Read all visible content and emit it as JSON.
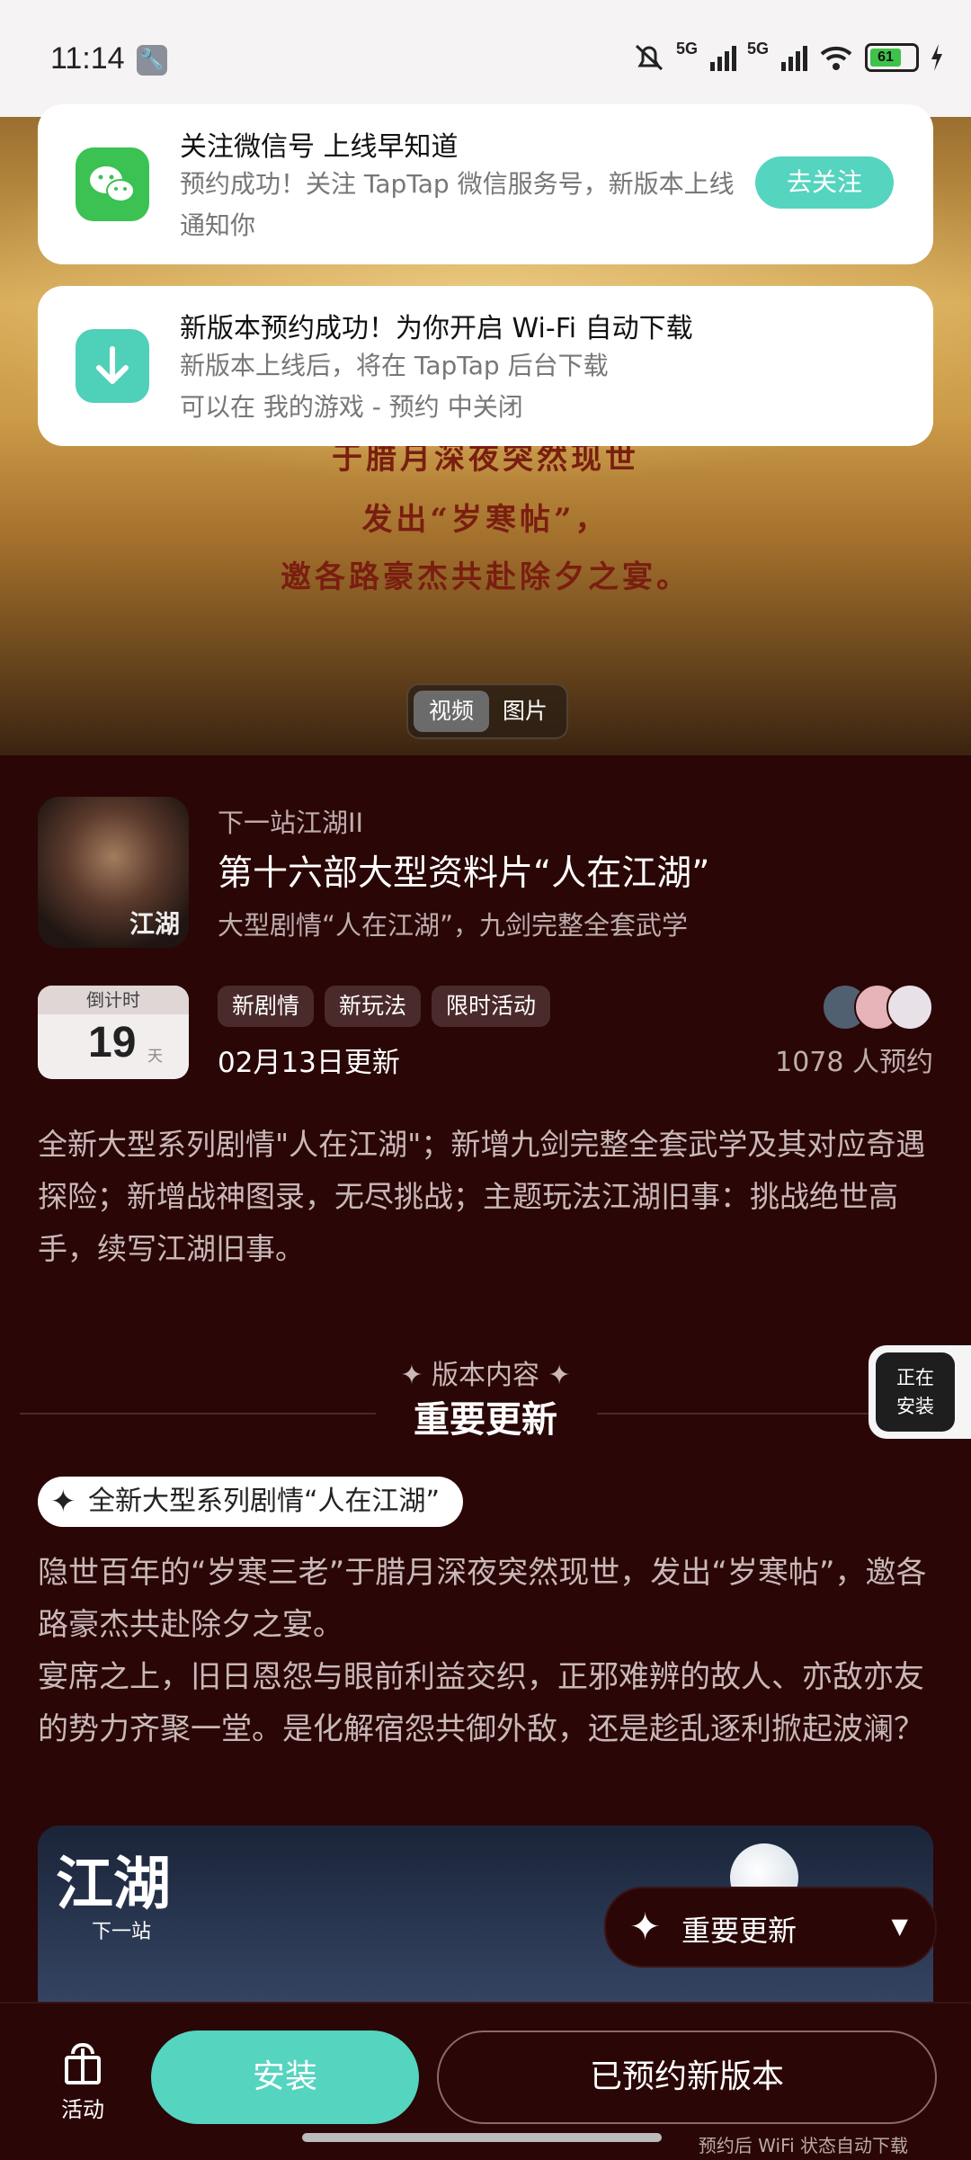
{
  "status_bar": {
    "time": "11:14",
    "network_1": "5G",
    "network_2": "5G",
    "battery": "61"
  },
  "notifications": [
    {
      "title": "关注微信号 上线早知道",
      "body": "预约成功！关注 TapTap 微信服务号，新版本上线通知你",
      "button": "去关注",
      "icon": "wechat-icon"
    },
    {
      "title": "新版本预约成功！为你开启 Wi-Fi 自动下载",
      "body_line1": "新版本上线后，将在 TapTap 后台下载",
      "body_line2": "可以在 我的游戏 - 预约 中关闭",
      "icon": "download-icon"
    }
  ],
  "hero": {
    "lines": [
      "于腊月深夜突然现世",
      "发出“岁寒帖”，",
      "邀各路豪杰共赴除夕之宴。"
    ],
    "tabs": [
      "视频",
      "图片"
    ],
    "selected_tab": "视频"
  },
  "game": {
    "icon_label": "江湖",
    "name": "下一站江湖II",
    "version_title": "第十六部大型资料片“人在江湖”",
    "version_subtitle": "大型剧情“人在江湖”，九剑完整全套武学"
  },
  "countdown": {
    "label": "倒计时",
    "value": "19",
    "unit": "天"
  },
  "tags": [
    "新剧情",
    "新玩法",
    "限时活动"
  ],
  "update_date": "02月13日更新",
  "reservations": "1078 人预约",
  "description": "全新大型系列剧情\"人在江湖\"；新增九剑完整全套武学及其对应奇遇探险；新增战神图录，无尽挑战；主题玩法江湖旧事：挑战绝世高手，续写江湖旧事。",
  "section": {
    "small": "✦ 版本内容 ✦",
    "title": "重要更新"
  },
  "installing_badge": {
    "line1": "正在",
    "line2": "安装"
  },
  "feature": {
    "pill": "全新大型系列剧情“人在江湖”",
    "paragraph1": "隐世百年的“岁寒三老”于腊月深夜突然现世，发出“岁寒帖”，邀各路豪杰共赴除夕之宴。",
    "paragraph2": "宴席之上，旧日恩怨与眼前利益交织，正邪难辨的故人、亦敌亦友的势力齐聚一堂。是化解宿怨共御外敌，还是趁乱逐利掀起波澜？"
  },
  "banner": {
    "logo": "江湖",
    "sub": "下一站"
  },
  "jump_menu": {
    "label": "重要更新"
  },
  "bottom_bar": {
    "activity_label": "活动",
    "install_label": "安装",
    "reserved_label": "已预约新版本",
    "wifi_note": "预约后 WiFi 状态自动下载"
  },
  "colors": {
    "accent": "#55d4bf",
    "background": "#2a0606",
    "wechat": "#3cc153"
  }
}
